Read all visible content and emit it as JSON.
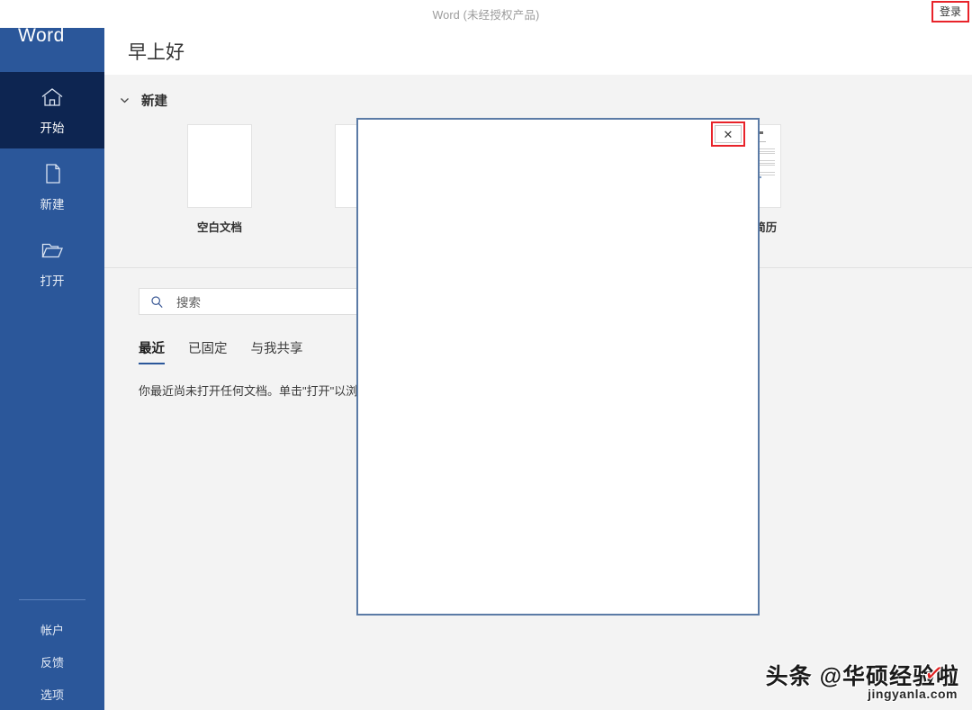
{
  "titlebar": {
    "title": "Word (未经授权产品)",
    "signin_label": "登录"
  },
  "sidebar": {
    "brand": "Word",
    "items": [
      {
        "label": "开始",
        "icon": "home-icon",
        "active": true
      },
      {
        "label": "新建",
        "icon": "new-document-icon",
        "active": false
      },
      {
        "label": "打开",
        "icon": "open-folder-icon",
        "active": false
      }
    ],
    "bottom_items": [
      {
        "label": "帐户"
      },
      {
        "label": "反馈"
      },
      {
        "label": "选项"
      }
    ]
  },
  "main": {
    "greeting": "早上好",
    "new_section": {
      "title": "新建",
      "chevron_icon": "chevron-down-icon",
      "templates": [
        {
          "label": "空白文档",
          "kind": "blank"
        },
        {
          "label": "",
          "kind": "blank"
        },
        {
          "label": "蓝灰色简历",
          "kind": "resume"
        }
      ]
    },
    "recent": {
      "search_placeholder": "搜索",
      "search_value": "",
      "search_icon": "search-icon",
      "tabs": [
        {
          "label": "最近",
          "active": true
        },
        {
          "label": "已固定",
          "active": false
        },
        {
          "label": "与我共享",
          "active": false
        }
      ],
      "empty_message": "你最近尚未打开任何文档。单击\"打开\"以浏览文档。"
    }
  },
  "dialog": {
    "close_label": "✕",
    "close_icon": "close-icon"
  },
  "watermark": {
    "main": "头条 @华硕经验啦",
    "check": "✓",
    "sub": "jingyanla.com"
  },
  "colors": {
    "sidebar": "#2b579a",
    "sidebar_active": "#0d2551",
    "accent": "#2b579a",
    "annotation_red": "#e8232a",
    "dialog_border": "#5b7ba6",
    "content_bg": "#f3f3f3"
  }
}
